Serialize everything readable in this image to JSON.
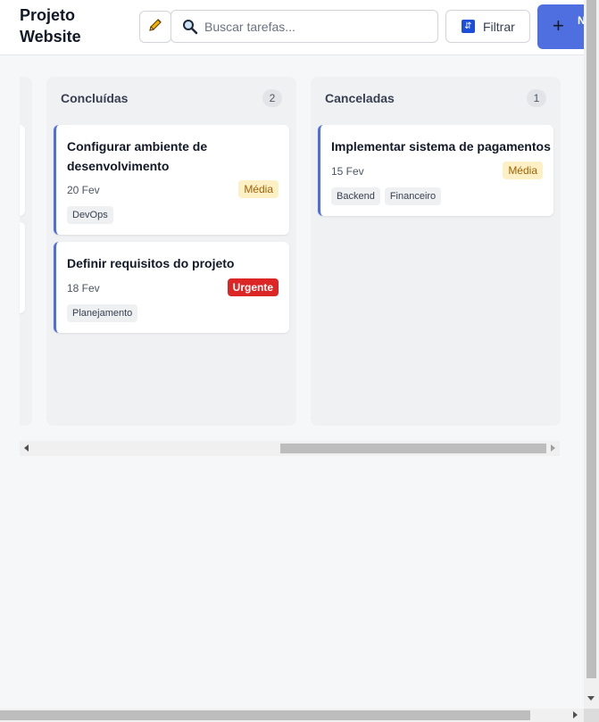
{
  "header": {
    "project_title": "Projeto Website",
    "search_placeholder": "Buscar tarefas...",
    "filter_label": "Filtrar",
    "new_task_label": "N T",
    "colors": {
      "primary": "#4f6fe0"
    }
  },
  "columns": [
    {
      "title": "Concluídas",
      "count": "2",
      "cards": [
        {
          "title": "Configurar ambiente de desenvolvimento",
          "date": "20 Fev",
          "priority": "Média",
          "tags": [
            "DevOps"
          ]
        },
        {
          "title": "Definir requisitos do projeto",
          "date": "18 Fev",
          "priority": "Urgente",
          "tags": [
            "Planejamento"
          ]
        }
      ]
    },
    {
      "title": "Canceladas",
      "count": "1",
      "cards": [
        {
          "title": "Implementar sistema de pagamentos",
          "date": "15 Fev",
          "priority": "Média",
          "tags": [
            "Backend",
            "Financeiro"
          ]
        }
      ]
    }
  ],
  "icons": {
    "edit": "pencil-icon",
    "search": "magnifier-icon",
    "filter": "filter-icon",
    "add": "plus-icon"
  }
}
